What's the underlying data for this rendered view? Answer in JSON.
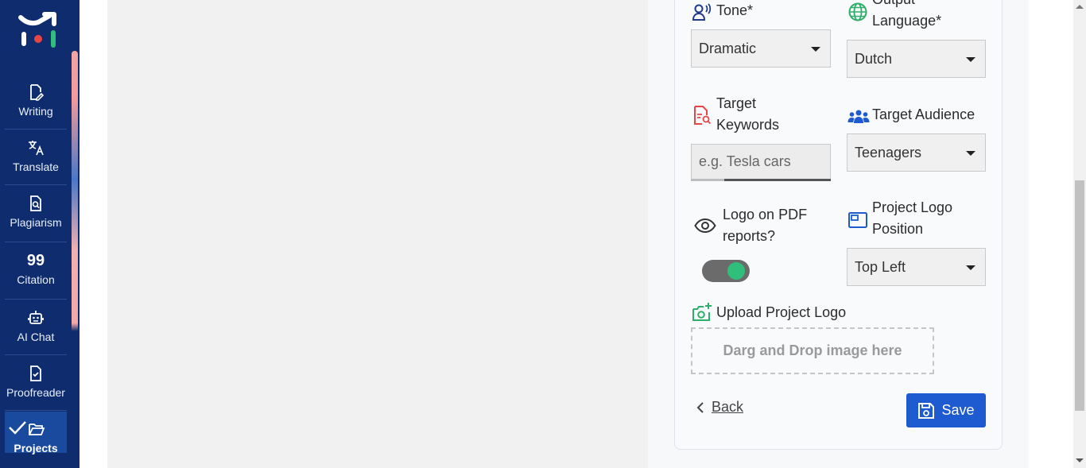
{
  "sidebar": {
    "items": [
      {
        "label": "Writing",
        "icon": "writing-icon"
      },
      {
        "label": "Translate",
        "icon": "translate-icon"
      },
      {
        "label": "Plagiarism",
        "icon": "plagiarism-icon"
      },
      {
        "label": "Citation",
        "icon": "citation-icon"
      },
      {
        "label": "AI Chat",
        "icon": "ai-chat-icon"
      },
      {
        "label": "Proofreader",
        "icon": "proofreader-icon"
      },
      {
        "label": "Projects",
        "icon": "projects-icon"
      }
    ]
  },
  "form": {
    "tone": {
      "label": "Tone*",
      "value": "Dramatic"
    },
    "output_language": {
      "label": "Output Language*",
      "value": "Dutch"
    },
    "target_keywords": {
      "label": "Target Keywords",
      "placeholder": "e.g. Tesla cars"
    },
    "target_audience": {
      "label": "Target Audience",
      "value": "Teenagers"
    },
    "logo_on_pdf": {
      "label": "Logo on PDF reports?",
      "enabled": true
    },
    "logo_position": {
      "label": "Project Logo Position",
      "value": "Top Left"
    },
    "upload_logo": {
      "label": "Upload Project Logo",
      "dropzone": "Darg and Drop image here"
    }
  },
  "actions": {
    "back": "Back",
    "save": "Save"
  },
  "colors": {
    "sidebar": "#0f2d6e",
    "accent": "#1f5bd0",
    "toggle_on": "#2fbf7a"
  }
}
